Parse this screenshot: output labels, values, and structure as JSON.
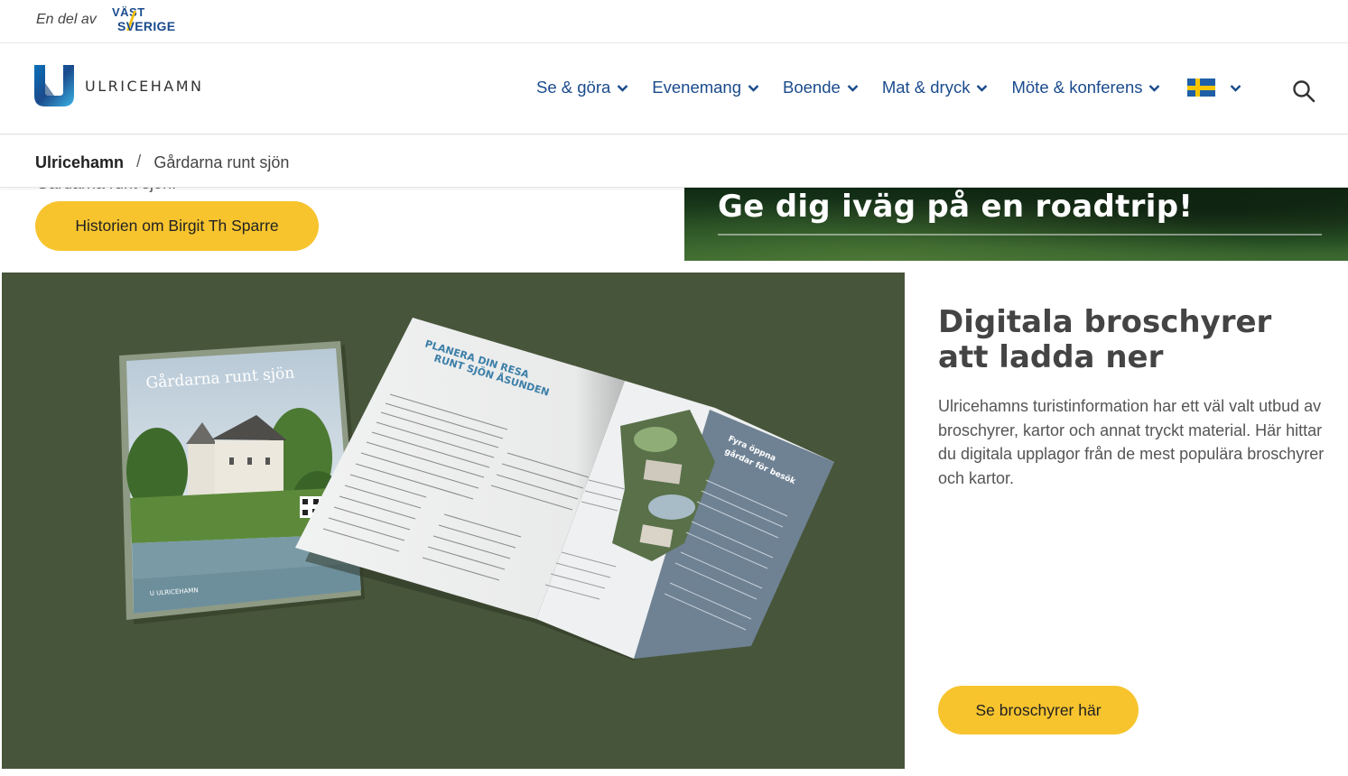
{
  "topstrip": {
    "partof": "En del av",
    "partner_logo_line1": "VÄST",
    "partner_logo_line2": "SVERIGE"
  },
  "brand": {
    "name": "ULRICEHAMN"
  },
  "nav": {
    "items": [
      {
        "label": "Se & göra"
      },
      {
        "label": "Evenemang"
      },
      {
        "label": "Boende"
      },
      {
        "label": "Mat & dryck"
      },
      {
        "label": "Möte & konferens"
      }
    ],
    "language_flag": "sweden-flag-icon"
  },
  "breadcrumb": {
    "home": "Ulricehamn",
    "separator": "/",
    "current": "Gårdarna runt sjön"
  },
  "hero_left": {
    "ghost_text": "Gårdarna runt sjön.",
    "button": "Historien om Birgit Th Sparre"
  },
  "roadtrip": {
    "title": "Ge dig iväg på en roadtrip!"
  },
  "brochure_section": {
    "heading": "Digitala broschyrer att ladda ner",
    "body": "Ulricehamns turistinformation har ett väl valt utbud av broschyrer, kartor och annat tryckt material. Här hittar du digitala upplagor från de mest populära broschyrer och kartor.",
    "button": "Se broschyrer här",
    "image": {
      "cover_title": "Gårdarna runt sjön",
      "page_heading": "PLANERA DIN RESA RUNT SJÖN ÅSUNDEN",
      "side_heading": "Fyra öppna gårdar för besök",
      "cover_footer": "ULRICEHAMN"
    }
  },
  "colors": {
    "accent": "#f7c42e",
    "nav_link": "#1a4b8c",
    "panel_bg": "#47553a"
  }
}
